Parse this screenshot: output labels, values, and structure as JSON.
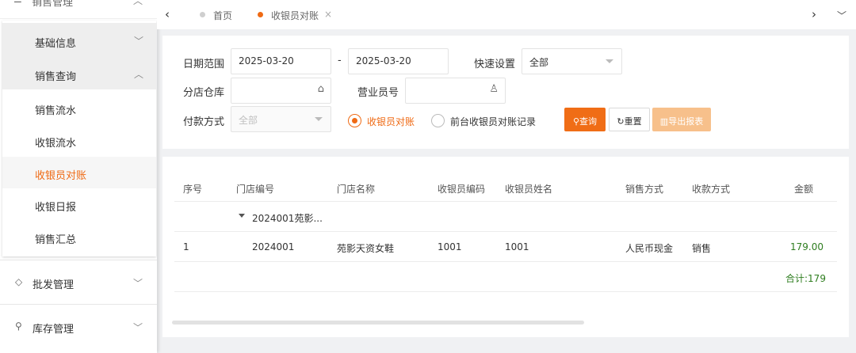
{
  "sidebar": {
    "top_item": {
      "label": "销售管理"
    },
    "groups": [
      {
        "label": "基础信息"
      },
      {
        "label": "销售查询"
      }
    ],
    "items": [
      {
        "label": "销售流水"
      },
      {
        "label": "收银流水"
      },
      {
        "label": "收银员对账"
      },
      {
        "label": "收银日报"
      },
      {
        "label": "销售汇总"
      }
    ],
    "bottom": [
      {
        "label": "批发管理"
      },
      {
        "label": "库存管理"
      }
    ]
  },
  "tabs": {
    "items": [
      {
        "label": "首页"
      },
      {
        "label": "收银员对账",
        "close": "×"
      }
    ]
  },
  "filter": {
    "date_label": "日期范围",
    "date_start": "2025-03-20",
    "date_sep": "-",
    "date_end": "2025-03-20",
    "quick_label": "快速设置",
    "quick_value": "全部",
    "warehouse_label": "分店仓库",
    "clerk_label": "营业员号",
    "payment_label": "付款方式",
    "payment_placeholder": "全部",
    "radio_1": "收银员对账",
    "radio_2": "前台收银员对账记录",
    "query_button": "查询",
    "reset_button": "重置",
    "export_button": "导出报表"
  },
  "table": {
    "headers": {
      "seq": "序号",
      "store_code": "门店编号",
      "store_name": "门店名称",
      "cashier_code": "收银员编码",
      "cashier_name": "收银员姓名",
      "sale_method": "销售方式",
      "pay_method": "收款方式",
      "amount": "金额"
    },
    "group_label": "2024001苑影...",
    "rows": [
      {
        "seq": "1",
        "store_code": "2024001",
        "store_name": "苑影天资女鞋",
        "cashier_code": "1001",
        "cashier_name": "1001",
        "sale_method": "人民币现金",
        "pay_method": "销售",
        "amount": "179.00"
      }
    ],
    "total": "合计:179"
  },
  "colors": {
    "accent": "#ef6a14",
    "amount": "#2e7d1f"
  }
}
